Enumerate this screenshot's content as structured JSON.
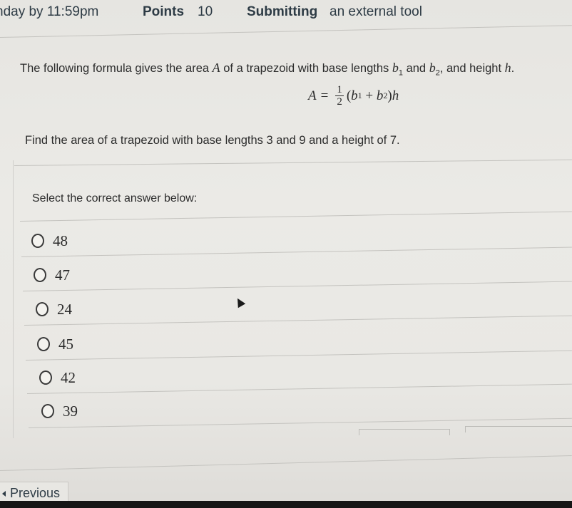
{
  "header": {
    "due": "nday by 11:59pm",
    "points_label": "Points",
    "points_value": "10",
    "submitting_label": "Submitting",
    "submitting_value": "an external tool"
  },
  "question": {
    "intro_prefix": "The following formula gives the area ",
    "intro_var_A": "A",
    "intro_mid": " of a trapezoid with base lengths ",
    "b1": "b",
    "b1_sub": "1",
    "and": " and ",
    "b2": "b",
    "b2_sub": "2",
    "intro_suffix": ", and height ",
    "h": "h",
    "period": ".",
    "formula": {
      "lhs": "A",
      "equals": "=",
      "frac_num": "1",
      "frac_den": "2",
      "rest_open": "(",
      "b1": "b",
      "b1_sub": "1",
      "plus": " + ",
      "b2": "b",
      "b2_sub": "2",
      "rest_close": ")",
      "h": "h"
    },
    "prompt": "Find the area of a trapezoid with base lengths 3 and 9 and a height of 7."
  },
  "answers": {
    "label": "Select the correct answer below:",
    "options": [
      {
        "value": "48",
        "selected": false
      },
      {
        "value": "47",
        "selected": false
      },
      {
        "value": "24",
        "selected": false
      },
      {
        "value": "45",
        "selected": false
      },
      {
        "value": "42",
        "selected": false
      },
      {
        "value": "39",
        "selected": false
      }
    ]
  },
  "nav": {
    "previous_label": "Previous"
  }
}
